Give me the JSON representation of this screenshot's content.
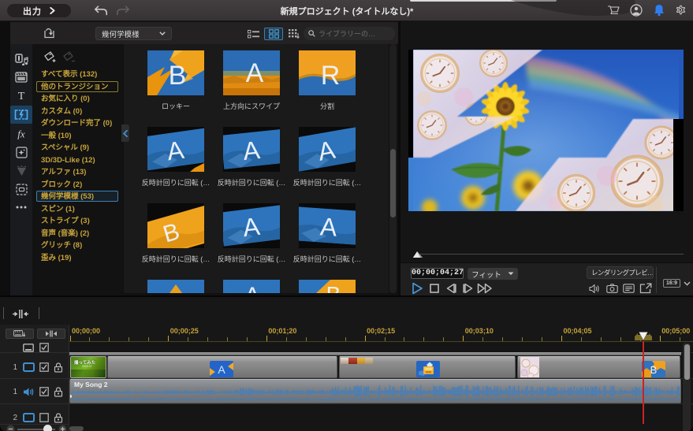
{
  "title_bar": {
    "produce_label": "出力",
    "title": "新規プロジェクト (タイトルなし)*"
  },
  "library": {
    "header": {
      "category_dropdown": "幾何学模様",
      "search_placeholder": "ライブラリーの…"
    },
    "categories": [
      {
        "label": "すべて表示 (132)",
        "state": "normal"
      },
      {
        "label": "他のトランジション",
        "state": "outlined"
      },
      {
        "label": "お気に入り (0)",
        "state": "normal"
      },
      {
        "label": "カスタム (0)",
        "state": "normal"
      },
      {
        "label": "ダウンロード完了 (0)",
        "state": "normal"
      },
      {
        "label": "一般 (10)",
        "state": "normal"
      },
      {
        "label": "スペシャル (9)",
        "state": "normal"
      },
      {
        "label": "3D/3D-Like (12)",
        "state": "normal"
      },
      {
        "label": "アルファ (13)",
        "state": "normal"
      },
      {
        "label": "ブロック (2)",
        "state": "normal"
      },
      {
        "label": "幾何学模様 (53)",
        "state": "selected"
      },
      {
        "label": "スピン (1)",
        "state": "normal"
      },
      {
        "label": "ストライプ (3)",
        "state": "normal"
      },
      {
        "label": "音声 (音楽) (2)",
        "state": "normal"
      },
      {
        "label": "グリッチ (8)",
        "state": "normal"
      },
      {
        "label": "歪み (19)",
        "state": "normal"
      }
    ],
    "thumbnails": [
      {
        "label": "ロッキー",
        "variant": "rocky"
      },
      {
        "label": "上方向にスワイプ",
        "variant": "swipeup"
      },
      {
        "label": "分割",
        "variant": "split"
      },
      {
        "label": "反時計回りに回転 (…",
        "variant": "rotA1"
      },
      {
        "label": "反時計回りに回転 (…",
        "variant": "rotA2"
      },
      {
        "label": "反時計回りに回転 (…",
        "variant": "rotA3"
      },
      {
        "label": "反時計回りに回転 (…",
        "variant": "rotB"
      },
      {
        "label": "反時計回りに回転 (…",
        "variant": "rotA4"
      },
      {
        "label": "反時計回りに回転 (…",
        "variant": "rotA5"
      },
      {
        "label": "",
        "variant": "sliver1"
      },
      {
        "label": "",
        "variant": "sliver2"
      },
      {
        "label": "",
        "variant": "sliver3"
      }
    ]
  },
  "preview": {
    "timecode": "00;00;04;27",
    "fit_label": "フィット",
    "render_preview_label": "レンダリングプレビ…",
    "aspect_ratio": "16:9"
  },
  "timeline": {
    "ruler_labels": [
      "00;00;00",
      "00;00;25",
      "00;01;20",
      "00;02;15",
      "00;03;10",
      "00;04;05",
      "00;05;00"
    ],
    "video_clip_name": "撮ってみた",
    "audio_clip_name": "My Song 2",
    "tracks": [
      {
        "num": "1",
        "type": "video"
      },
      {
        "num": "1",
        "type": "audio"
      },
      {
        "num": "2",
        "type": "video"
      }
    ]
  },
  "colors": {
    "accent_blue": "#3f8fd2",
    "ruler_gold": "#c7a43b",
    "playhead_red": "#cc2222",
    "bell_blue": "#2f7df0",
    "thumb_orange": "#eb9c1e",
    "thumb_blue": "#2d6fb8"
  }
}
